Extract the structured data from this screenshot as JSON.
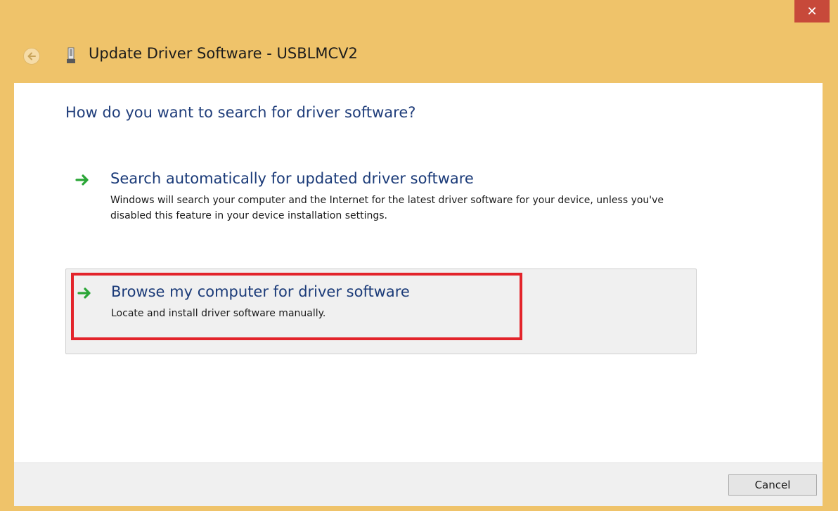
{
  "titlebar": {
    "close_symbol": "✕",
    "close_color": "#c7493a"
  },
  "header": {
    "back_icon": "back-arrow-icon",
    "device_icon": "usb-device-icon",
    "title": "Update Driver Software - USBLMCV2"
  },
  "main": {
    "question": "How do you want to search for driver software?",
    "options": [
      {
        "icon": "green-arrow-icon",
        "title": "Search automatically for updated driver software",
        "description": "Windows will search your computer and the Internet for the latest driver software for your device, unless you've disabled this feature in your device installation settings."
      },
      {
        "icon": "green-arrow-icon",
        "title": "Browse my computer for driver software",
        "description": "Locate and install driver software manually.",
        "highlighted": true
      }
    ]
  },
  "footer": {
    "cancel_label": "Cancel"
  },
  "colors": {
    "frame": "#efc36a",
    "accent_text": "#1f3d7a",
    "highlight_box": "#e3242b"
  }
}
